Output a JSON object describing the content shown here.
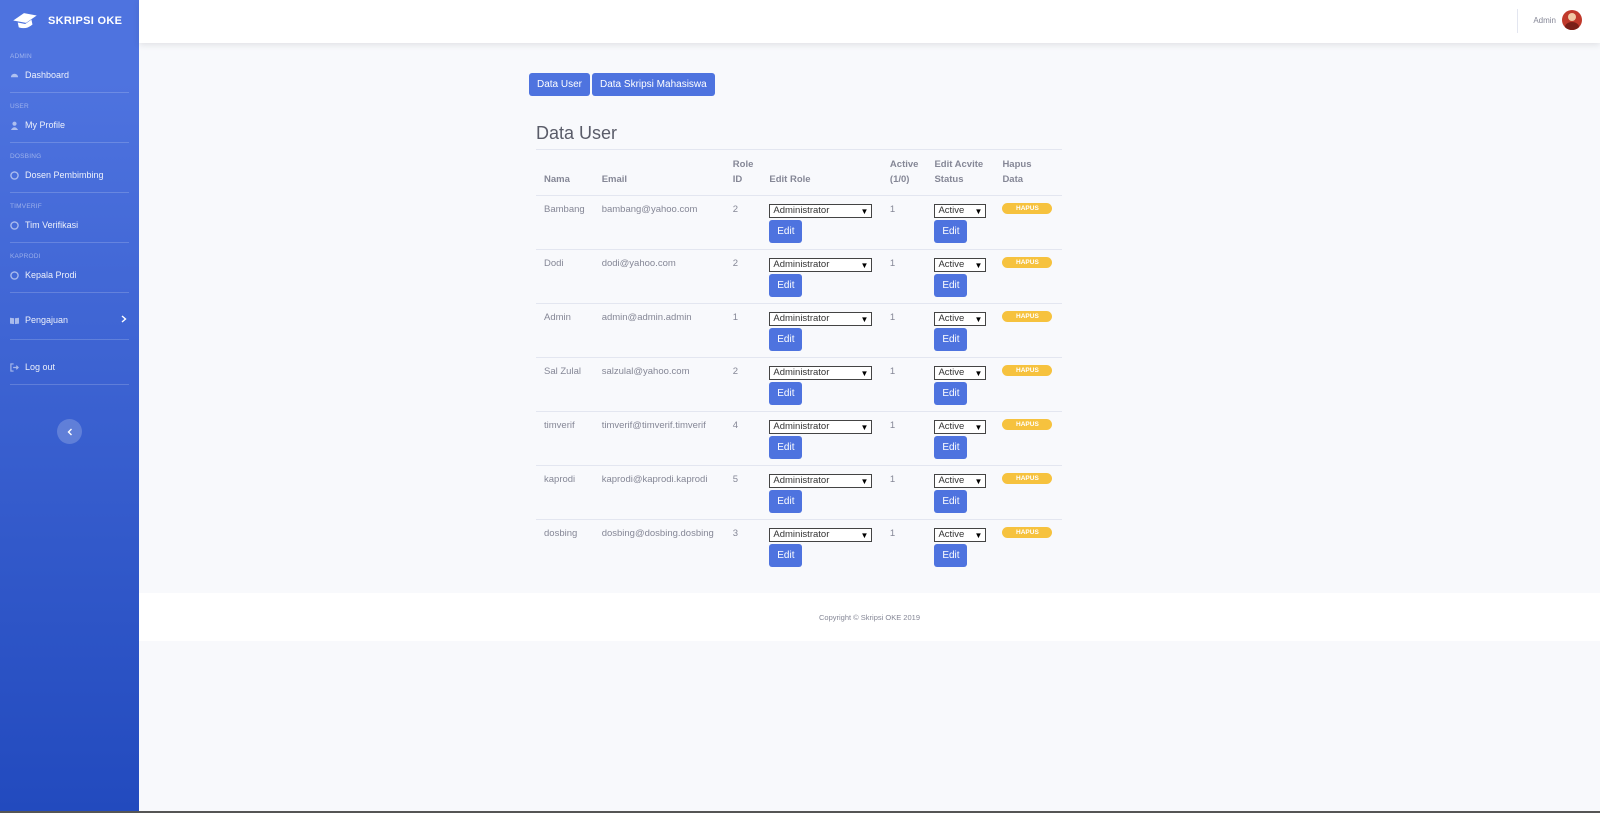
{
  "brand": {
    "name": "SKRIPSI OKE"
  },
  "sidebar": {
    "sections": [
      {
        "heading": "ADMIN",
        "item": "Dashboard",
        "icon": "dashboard-icon"
      },
      {
        "heading": "USER",
        "item": "My Profile",
        "icon": "user-icon"
      },
      {
        "heading": "DOSBING",
        "item": "Dosen Pembimbing",
        "icon": "circle-icon"
      },
      {
        "heading": "TIMVERIF",
        "item": "Tim Verifikasi",
        "icon": "circle-icon"
      },
      {
        "heading": "KAPRODI",
        "item": "Kepala Prodi",
        "icon": "circle-icon"
      }
    ],
    "pengajuan": "Pengajuan",
    "logout": "Log out"
  },
  "topbar": {
    "username": "Admin"
  },
  "buttons": {
    "data_user": "Data User",
    "data_skripsi": "Data Skripsi Mahasiswa"
  },
  "page_title": "Data User",
  "table": {
    "headers": {
      "nama": "Nama",
      "email": "Email",
      "role_1": "Role",
      "role_2": "ID",
      "edit_role": "Edit Role",
      "active_1": "Active",
      "active_2": "(1/0)",
      "edit_status_1": "Edit Acvite",
      "edit_status_2": "Status",
      "hapus_1": "Hapus",
      "hapus_2": "Data"
    },
    "rows": [
      {
        "nama": "Bambang",
        "email": "bambang@yahoo.com",
        "role_id": "2",
        "role_select": "Administrator",
        "active": "1",
        "status_select": "Active"
      },
      {
        "nama": "Dodi",
        "email": "dodi@yahoo.com",
        "role_id": "2",
        "role_select": "Administrator",
        "active": "1",
        "status_select": "Active"
      },
      {
        "nama": "Admin",
        "email": "admin@admin.admin",
        "role_id": "1",
        "role_select": "Administrator",
        "active": "1",
        "status_select": "Active"
      },
      {
        "nama": "Sal Zulal",
        "email": "salzulal@yahoo.com",
        "role_id": "2",
        "role_select": "Administrator",
        "active": "1",
        "status_select": "Active"
      },
      {
        "nama": "timverif",
        "email": "timverif@timverif.timverif",
        "role_id": "4",
        "role_select": "Administrator",
        "active": "1",
        "status_select": "Active"
      },
      {
        "nama": "kaprodi",
        "email": "kaprodi@kaprodi.kaprodi",
        "role_id": "5",
        "role_select": "Administrator",
        "active": "1",
        "status_select": "Active"
      },
      {
        "nama": "dosbing",
        "email": "dosbing@dosbing.dosbing",
        "role_id": "3",
        "role_select": "Administrator",
        "active": "1",
        "status_select": "Active"
      }
    ],
    "edit_label": "Edit",
    "hapus_label": "HAPUS"
  },
  "footer": {
    "copyright": "Copyright © Skripsi OKE 2019"
  },
  "colors": {
    "primary": "#4e73df",
    "primary_dark": "#224abe",
    "warning": "#f6c23e",
    "background": "#f8f9fc"
  }
}
